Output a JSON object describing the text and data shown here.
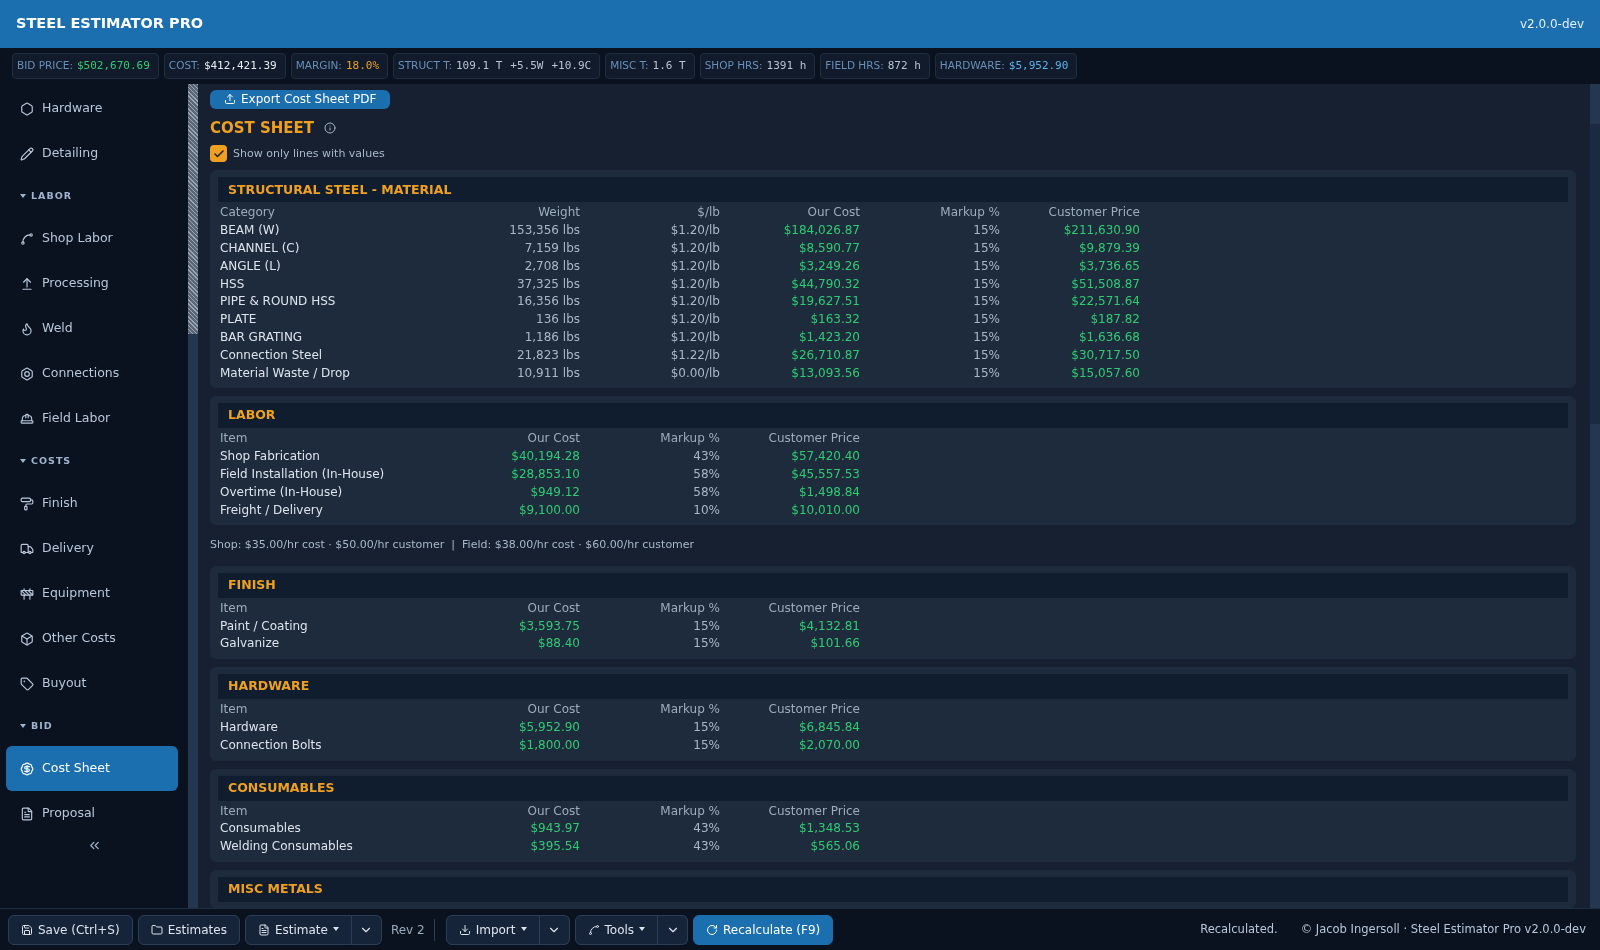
{
  "header": {
    "title": "STEEL ESTIMATOR PRO",
    "version": "v2.0.0-dev"
  },
  "stats": [
    {
      "label": "BID PRICE:",
      "values": [
        "$502,670.69"
      ],
      "color": "#2ecc71"
    },
    {
      "label": "COST:",
      "values": [
        "$412,421.39"
      ],
      "color": "#e8edf3"
    },
    {
      "label": "MARGIN:",
      "values": [
        "18.0%"
      ],
      "color": "#f0a020"
    },
    {
      "label": "STRUCT T:",
      "values": [
        "109.1 T",
        "+5.5W",
        "+10.9C"
      ],
      "color": "#b8c4d2"
    },
    {
      "label": "MISC T:",
      "values": [
        "1.6 T"
      ],
      "color": "#b8c4d2"
    },
    {
      "label": "SHOP HRS:",
      "values": [
        "1391 h"
      ],
      "color": "#b8c4d2"
    },
    {
      "label": "FIELD HRS:",
      "values": [
        "872 h"
      ],
      "color": "#b8c4d2"
    },
    {
      "label": "HARDWARE:",
      "values": [
        "$5,952.90"
      ],
      "color": "#5ab4f0"
    }
  ],
  "sidebar": {
    "items": [
      {
        "label": "Hardware",
        "selected": false
      },
      {
        "label": "Detailing",
        "selected": false
      }
    ],
    "groups": [
      {
        "label": "LABOR",
        "expanded": true,
        "items": [
          {
            "label": "Shop Labor",
            "selected": false
          },
          {
            "label": "Processing",
            "selected": false
          },
          {
            "label": "Weld",
            "selected": false
          },
          {
            "label": "Connections",
            "selected": false
          },
          {
            "label": "Field Labor",
            "selected": false
          }
        ]
      },
      {
        "label": "COSTS",
        "expanded": true,
        "items": [
          {
            "label": "Finish",
            "selected": false
          },
          {
            "label": "Delivery",
            "selected": false
          },
          {
            "label": "Equipment",
            "selected": false
          },
          {
            "label": "Other Costs",
            "selected": false
          },
          {
            "label": "Buyout",
            "selected": false
          }
        ]
      },
      {
        "label": "BID",
        "expanded": true,
        "items": [
          {
            "label": "Cost Sheet",
            "selected": true
          },
          {
            "label": "Proposal",
            "selected": false
          }
        ]
      }
    ]
  },
  "export_button": "Export Cost Sheet PDF",
  "page_title": "COST SHEET",
  "filter": {
    "label": "Show only lines with values",
    "checked": true
  },
  "sections": [
    {
      "title": "STRUCTURAL STEEL - MATERIAL",
      "columns": [
        {
          "label": "Category",
          "kind": "name"
        },
        {
          "label": "Weight",
          "kind": "num"
        },
        {
          "label": "$/lb",
          "kind": "num"
        },
        {
          "label": "Our Cost",
          "kind": "money"
        },
        {
          "label": "Markup %",
          "kind": "num"
        },
        {
          "label": "Customer Price",
          "kind": "money"
        }
      ],
      "rows": [
        [
          "BEAM (W)",
          "153,356 lbs",
          "$1.20/lb",
          "$184,026.87",
          "15%",
          "$211,630.90"
        ],
        [
          "CHANNEL (C)",
          "7,159 lbs",
          "$1.20/lb",
          "$8,590.77",
          "15%",
          "$9,879.39"
        ],
        [
          "ANGLE (L)",
          "2,708 lbs",
          "$1.20/lb",
          "$3,249.26",
          "15%",
          "$3,736.65"
        ],
        [
          "HSS",
          "37,325 lbs",
          "$1.20/lb",
          "$44,790.32",
          "15%",
          "$51,508.87"
        ],
        [
          "PIPE & ROUND HSS",
          "16,356 lbs",
          "$1.20/lb",
          "$19,627.51",
          "15%",
          "$22,571.64"
        ],
        [
          "PLATE",
          "136 lbs",
          "$1.20/lb",
          "$163.32",
          "15%",
          "$187.82"
        ],
        [
          "BAR GRATING",
          "1,186 lbs",
          "$1.20/lb",
          "$1,423.20",
          "15%",
          "$1,636.68"
        ],
        [
          "Connection Steel",
          "21,823 lbs",
          "$1.22/lb",
          "$26,710.87",
          "15%",
          "$30,717.50"
        ],
        [
          "Material Waste / Drop",
          "10,911 lbs",
          "$0.00/lb",
          "$13,093.56",
          "15%",
          "$15,057.60"
        ]
      ]
    },
    {
      "title": "LABOR",
      "columns": [
        {
          "label": "Item",
          "kind": "name"
        },
        {
          "label": "Our Cost",
          "kind": "money"
        },
        {
          "label": "Markup %",
          "kind": "num"
        },
        {
          "label": "Customer Price",
          "kind": "money"
        }
      ],
      "rows": [
        [
          "Shop Fabrication",
          "$40,194.28",
          "43%",
          "$57,420.40"
        ],
        [
          "Field Installation (In-House)",
          "$28,853.10",
          "58%",
          "$45,557.53"
        ],
        [
          "Overtime (In-House)",
          "$949.12",
          "58%",
          "$1,498.84"
        ],
        [
          "Freight / Delivery",
          "$9,100.00",
          "10%",
          "$10,010.00"
        ]
      ],
      "note": "Shop: $35.00/hr cost · $50.00/hr customer  |  Field: $38.00/hr cost · $60.00/hr customer"
    },
    {
      "title": "FINISH",
      "columns": [
        {
          "label": "Item",
          "kind": "name"
        },
        {
          "label": "Our Cost",
          "kind": "money"
        },
        {
          "label": "Markup %",
          "kind": "num"
        },
        {
          "label": "Customer Price",
          "kind": "money"
        }
      ],
      "rows": [
        [
          "Paint / Coating",
          "$3,593.75",
          "15%",
          "$4,132.81"
        ],
        [
          "Galvanize",
          "$88.40",
          "15%",
          "$101.66"
        ]
      ]
    },
    {
      "title": "HARDWARE",
      "columns": [
        {
          "label": "Item",
          "kind": "name"
        },
        {
          "label": "Our Cost",
          "kind": "money"
        },
        {
          "label": "Markup %",
          "kind": "num"
        },
        {
          "label": "Customer Price",
          "kind": "money"
        }
      ],
      "rows": [
        [
          "Hardware",
          "$5,952.90",
          "15%",
          "$6,845.84"
        ],
        [
          "Connection Bolts",
          "$1,800.00",
          "15%",
          "$2,070.00"
        ]
      ]
    },
    {
      "title": "CONSUMABLES",
      "columns": [
        {
          "label": "Item",
          "kind": "name"
        },
        {
          "label": "Our Cost",
          "kind": "money"
        },
        {
          "label": "Markup %",
          "kind": "num"
        },
        {
          "label": "Customer Price",
          "kind": "money"
        }
      ],
      "rows": [
        [
          "Consumables",
          "$943.97",
          "43%",
          "$1,348.53"
        ],
        [
          "Welding Consumables",
          "$395.54",
          "43%",
          "$565.06"
        ]
      ]
    },
    {
      "title": "MISC METALS"
    }
  ],
  "toolbar": {
    "buttons": [
      {
        "label": "Save (Ctrl+S)",
        "kind": "save"
      },
      {
        "label": "Estimates",
        "kind": "folder"
      },
      {
        "label": "Estimate",
        "kind": "split-file"
      }
    ],
    "revision": "Rev 2",
    "tools": [
      {
        "label": "Import",
        "kind": "split-import"
      },
      {
        "label": "Tools",
        "kind": "split-tools"
      },
      {
        "label": "Recalculate (F9)",
        "kind": "primary"
      }
    ],
    "status": "Recalculated.",
    "copyright": "© Jacob Ingersoll · Steel Estimator Pro v2.0.0-dev"
  }
}
